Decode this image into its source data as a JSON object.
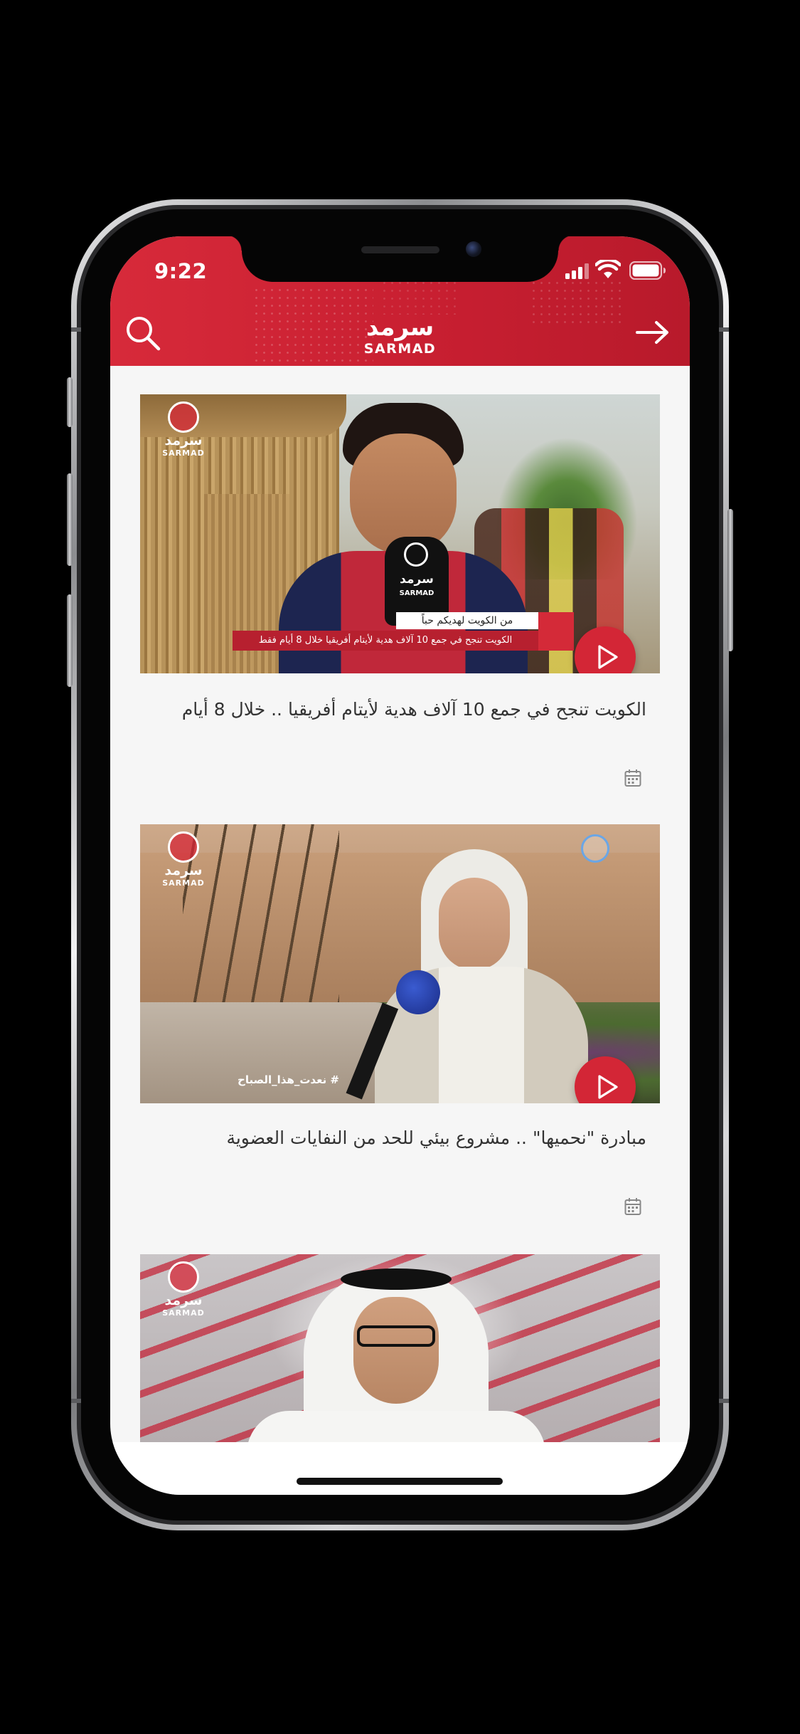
{
  "status_bar": {
    "time": "9:22"
  },
  "header": {
    "logo_arabic": "سرمد",
    "logo_latin": "SARMAD",
    "left_icon": "search-icon",
    "right_icon": "arrow-right-icon",
    "brand_color": "#c81f31"
  },
  "videos": [
    {
      "title": "الكويت تنجح في جمع 10 آلاف هدية لأيتام أفريقيا .. خلال 8 أيام",
      "thumbnail": "boy-with-microphone",
      "caption_line1": "من الكويت لهديكم حباً",
      "caption_line2": "الكويت تنجح في جمع 10 آلاف هدية لأيتام أفريقيا خلال 8 أيام فقط"
    },
    {
      "title": "مبادرة \"نحميها\" .. مشروع بيئي للحد من النفايات العضوية",
      "thumbnail": "woman-interview-garden",
      "caption_line1": "# نعدت_هذا_الصباح",
      "caption_line2": ""
    },
    {
      "title": "",
      "thumbnail": "man-in-studio",
      "caption_line1": "",
      "caption_line2": ""
    }
  ],
  "watermark": {
    "arabic": "سرمد",
    "latin": "SARMAD"
  },
  "icons": {
    "play": "play-icon",
    "date": "calendar-icon"
  }
}
